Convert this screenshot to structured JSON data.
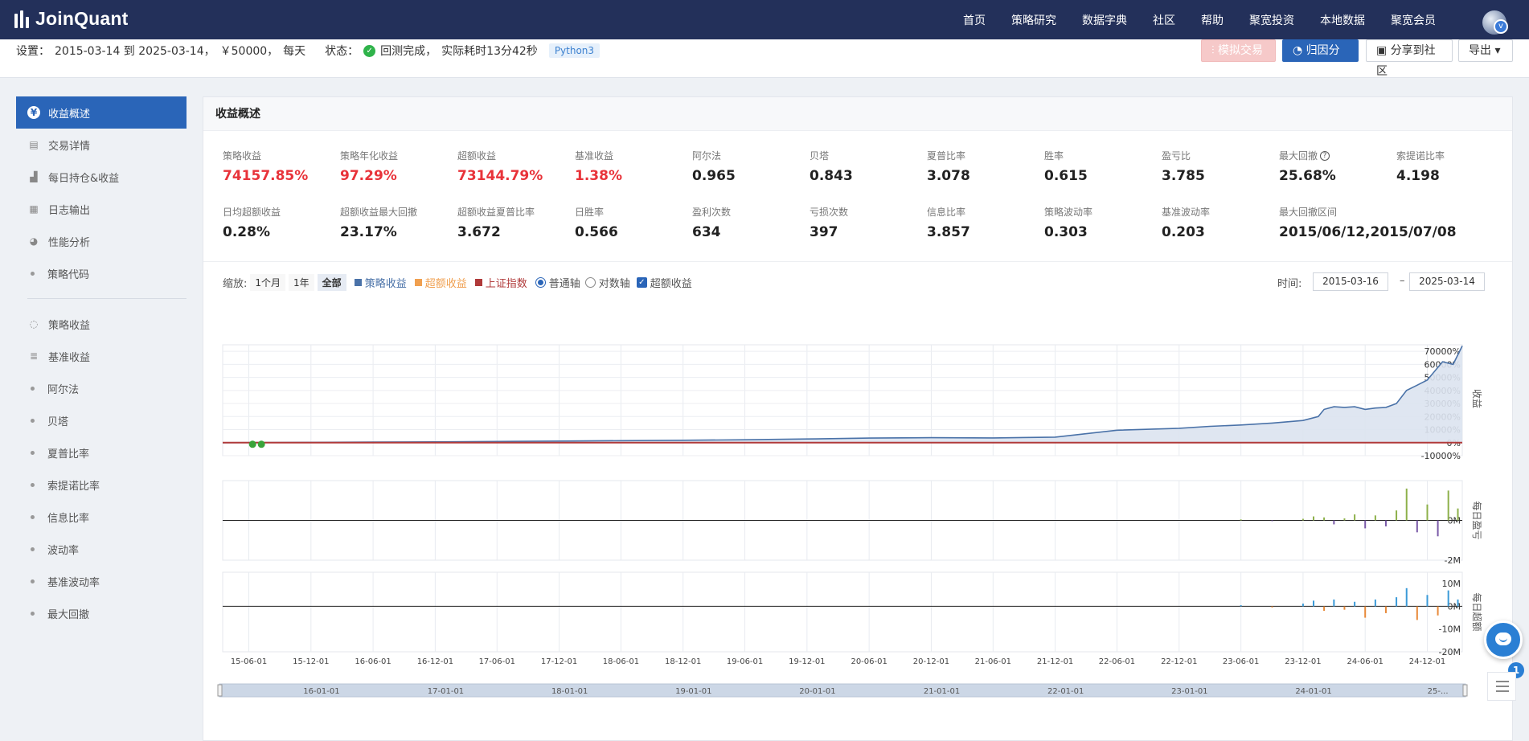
{
  "nav": {
    "brand": "JoinQuant",
    "items": [
      "首页",
      "策略研究",
      "数据字典",
      "社区",
      "帮助",
      "聚宽投资",
      "本地数据",
      "聚宽会员"
    ],
    "avatar_badge": "v"
  },
  "settings": {
    "label": "设置：",
    "range": "2015-03-14 到 2025-03-14，",
    "capital": "￥50000，",
    "frequency": "每天",
    "status_label": "状态：",
    "status_text": "回测完成，",
    "elapsed": "实际耗时13分42秒",
    "language": "Python3",
    "buttons": {
      "simulate": "模拟交易",
      "attribution": "归因分析",
      "share": "分享到社区",
      "export": "导出"
    }
  },
  "sidebar": {
    "group1": [
      {
        "label": "收益概述",
        "icon": "yen-icon",
        "active": true
      },
      {
        "label": "交易详情",
        "icon": "document-icon"
      },
      {
        "label": "每日持仓&收益",
        "icon": "bar-chart-icon"
      },
      {
        "label": "日志输出",
        "icon": "calendar-icon"
      },
      {
        "label": "性能分析",
        "icon": "pie-chart-icon"
      },
      {
        "label": "策略代码",
        "icon": "dot"
      }
    ],
    "group2": [
      {
        "label": "策略收益",
        "icon": "bulb-icon"
      },
      {
        "label": "基准收益",
        "icon": "database-icon"
      },
      {
        "label": "阿尔法",
        "icon": "dot"
      },
      {
        "label": "贝塔",
        "icon": "dot"
      },
      {
        "label": "夏普比率",
        "icon": "dot"
      },
      {
        "label": "索提诺比率",
        "icon": "dot"
      },
      {
        "label": "信息比率",
        "icon": "dot"
      },
      {
        "label": "波动率",
        "icon": "dot"
      },
      {
        "label": "基准波动率",
        "icon": "dot"
      },
      {
        "label": "最大回撤",
        "icon": "dot"
      }
    ]
  },
  "panel": {
    "title": "收益概述"
  },
  "metrics": [
    {
      "label": "策略收益",
      "value": "74157.85%",
      "red": true
    },
    {
      "label": "策略年化收益",
      "value": "97.29%",
      "red": true
    },
    {
      "label": "超额收益",
      "value": "73144.79%",
      "red": true
    },
    {
      "label": "基准收益",
      "value": "1.38%",
      "red": true
    },
    {
      "label": "阿尔法",
      "value": "0.965"
    },
    {
      "label": "贝塔",
      "value": "0.843"
    },
    {
      "label": "夏普比率",
      "value": "3.078"
    },
    {
      "label": "胜率",
      "value": "0.615"
    },
    {
      "label": "盈亏比",
      "value": "3.785"
    },
    {
      "label": "最大回撤",
      "value": "25.68%",
      "help": true
    },
    {
      "label": "索提诺比率",
      "value": "4.198"
    },
    {
      "label": "日均超额收益",
      "value": "0.28%"
    },
    {
      "label": "超额收益最大回撤",
      "value": "23.17%"
    },
    {
      "label": "超额收益夏普比率",
      "value": "3.672"
    },
    {
      "label": "日胜率",
      "value": "0.566"
    },
    {
      "label": "盈利次数",
      "value": "634"
    },
    {
      "label": "亏损次数",
      "value": "397"
    },
    {
      "label": "信息比率",
      "value": "3.857"
    },
    {
      "label": "策略波动率",
      "value": "0.303"
    },
    {
      "label": "基准波动率",
      "value": "0.203"
    },
    {
      "label": "最大回撤区间",
      "value": "2015/06/12,2015/07/08"
    }
  ],
  "controls": {
    "zoom_label": "缩放:",
    "zoom_options": [
      "1个月",
      "1年",
      "全部"
    ],
    "zoom_active": "全部",
    "legend": [
      {
        "label": "策略收益",
        "color": "#4a72a8"
      },
      {
        "label": "超额收益",
        "color": "#f0a050"
      },
      {
        "label": "上证指数",
        "color": "#b03a3a"
      }
    ],
    "axis_options": [
      "普通轴",
      "对数轴"
    ],
    "axis_selected": "普通轴",
    "excess_checkbox": "超额收益",
    "time_label": "时间:",
    "date_from": "2015-03-16",
    "date_sep": "–",
    "date_to": "2025-03-14"
  },
  "chart_data": [
    {
      "type": "area",
      "ylabel": "收益",
      "yticks": [
        "70000%",
        "60000%",
        "50000%",
        "40000%",
        "30000%",
        "20000%",
        "10000%",
        "0%",
        "-10000%"
      ],
      "ylim": [
        -10000,
        75000
      ],
      "series": [
        {
          "name": "策略收益",
          "color": "#4a72a8",
          "x": [
            "2015-03-16",
            "2015-12-01",
            "2016-06-01",
            "2016-12-01",
            "2017-06-01",
            "2017-12-01",
            "2018-06-01",
            "2018-12-01",
            "2019-06-01",
            "2019-12-01",
            "2020-06-01",
            "2020-12-01",
            "2021-06-01",
            "2021-12-01",
            "2022-06-01",
            "2022-12-01",
            "2023-03-01",
            "2023-06-01",
            "2023-09-01",
            "2023-12-01",
            "2024-01-15",
            "2024-02-01",
            "2024-03-01",
            "2024-04-01",
            "2024-05-01",
            "2024-06-01",
            "2024-07-01",
            "2024-08-01",
            "2024-09-01",
            "2024-10-01",
            "2024-11-01",
            "2024-12-01",
            "2025-01-15",
            "2025-02-15",
            "2025-03-14"
          ],
          "y": [
            0,
            200,
            400,
            600,
            900,
            1200,
            1500,
            1800,
            2200,
            2800,
            3500,
            3800,
            3600,
            4200,
            9500,
            11000,
            12500,
            13500,
            15000,
            17000,
            20000,
            25500,
            27500,
            27000,
            27500,
            25500,
            26500,
            27000,
            30000,
            40000,
            44000,
            48000,
            62000,
            60000,
            74157
          ]
        },
        {
          "name": "上证指数",
          "color": "#b03a3a",
          "x": [
            "2015-03-16",
            "2025-03-14"
          ],
          "y": [
            0,
            1.38
          ]
        }
      ],
      "markers": [
        "2015-06-12",
        "2015-07-08"
      ]
    },
    {
      "type": "bar",
      "ylabel": "每日盈亏",
      "yticks": [
        "0M",
        "-2M"
      ],
      "ylim": [
        -2,
        2
      ],
      "series": [
        {
          "name": "每日盈亏",
          "positive_color": "#8db04a",
          "negative_color": "#7a5aa8",
          "x": [
            "2023-06-01",
            "2023-09-01",
            "2023-12-01",
            "2024-01-01",
            "2024-02-01",
            "2024-03-01",
            "2024-04-01",
            "2024-05-01",
            "2024-06-01",
            "2024-07-01",
            "2024-08-01",
            "2024-09-01",
            "2024-10-01",
            "2024-11-01",
            "2024-12-01",
            "2025-01-01",
            "2025-02-01",
            "2025-03-01"
          ],
          "y": [
            0.05,
            -0.04,
            0.08,
            0.2,
            0.15,
            -0.2,
            0.1,
            0.3,
            -0.4,
            0.25,
            -0.3,
            0.5,
            1.6,
            -0.6,
            0.8,
            -0.8,
            1.5,
            0.6
          ]
        }
      ]
    },
    {
      "type": "bar",
      "ylabel": "每日超额",
      "yticks": [
        "10M",
        "0M",
        "-10M",
        "-20M"
      ],
      "ylim": [
        -20,
        15
      ],
      "series": [
        {
          "name": "每日超额",
          "positive_color": "#3a9ad8",
          "negative_color": "#e88a3a",
          "x": [
            "2023-06-01",
            "2023-09-01",
            "2023-12-01",
            "2024-01-01",
            "2024-02-01",
            "2024-03-01",
            "2024-04-01",
            "2024-05-01",
            "2024-06-01",
            "2024-07-01",
            "2024-08-01",
            "2024-09-01",
            "2024-10-01",
            "2024-11-01",
            "2024-12-01",
            "2025-01-01",
            "2025-02-01",
            "2025-03-01"
          ],
          "y": [
            0.5,
            -0.5,
            1.2,
            2.5,
            -2,
            3,
            -1.5,
            2,
            -5,
            3,
            -3,
            4,
            8,
            -6,
            5,
            -4,
            7,
            3
          ]
        }
      ]
    }
  ],
  "xaxis": {
    "ticks": [
      "15-06-01",
      "15-12-01",
      "16-06-01",
      "16-12-01",
      "17-06-01",
      "17-12-01",
      "18-06-01",
      "18-12-01",
      "19-06-01",
      "19-12-01",
      "20-06-01",
      "20-12-01",
      "21-06-01",
      "21-12-01",
      "22-06-01",
      "22-12-01",
      "23-06-01",
      "23-12-01",
      "24-06-01",
      "24-12-01"
    ],
    "navigator_ticks": [
      "16-01-01",
      "17-01-01",
      "18-01-01",
      "19-01-01",
      "20-01-01",
      "21-01-01",
      "22-01-01",
      "23-01-01",
      "24-01-01",
      "25-..."
    ]
  }
}
